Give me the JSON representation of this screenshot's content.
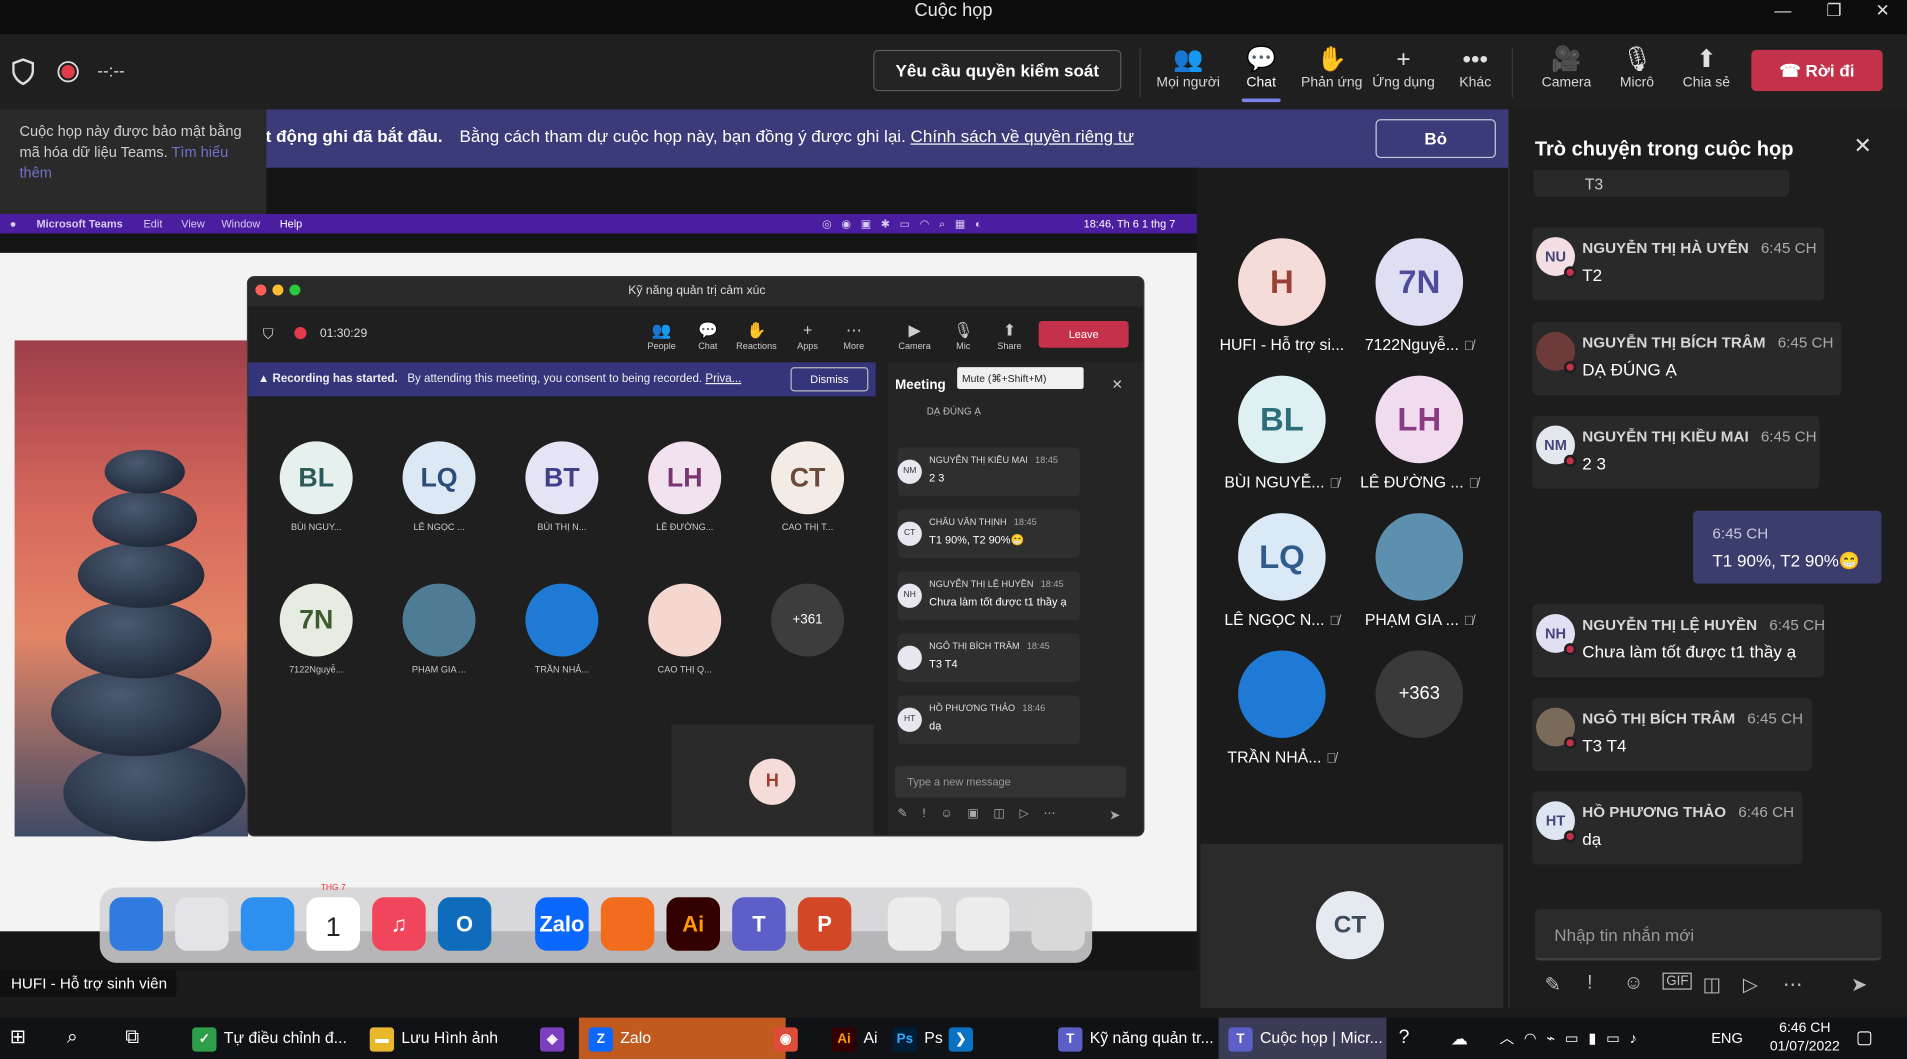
{
  "window": {
    "title": "Cuộc họp",
    "min": "—",
    "max": "❐",
    "close": "✕"
  },
  "meeting": {
    "timer": "--:--",
    "request_control": "Yêu cầu quyền kiểm soát",
    "toolbar": [
      {
        "label": "Mọi người",
        "icon": "people-icon",
        "glyph": "👥"
      },
      {
        "label": "Chat",
        "icon": "chat-icon",
        "glyph": "💬"
      },
      {
        "label": "Phản ứng",
        "icon": "reactions-icon",
        "glyph": "✋"
      },
      {
        "label": "Ứng dụng",
        "icon": "apps-icon",
        "glyph": "+"
      },
      {
        "label": "Khác",
        "icon": "more-icon",
        "glyph": "•••"
      }
    ],
    "av_controls": [
      {
        "label": "Camera",
        "icon": "camera-off-icon",
        "glyph": "🎥"
      },
      {
        "label": "Micrô",
        "icon": "mic-off-icon",
        "glyph": "🎙"
      },
      {
        "label": "Chia sẻ",
        "icon": "share-icon",
        "glyph": "⬆"
      }
    ],
    "leave": "Rời đi"
  },
  "encryption_popup": {
    "text": "Cuộc họp này được bảo mật bằng mã hóa dữ liệu Teams.",
    "link": "Tìm hiểu thêm"
  },
  "recording_banner": {
    "bold": "Hoạt động ghi đã bắt đầu.",
    "text": "Bằng cách tham dự cuộc họp này, bạn đồng ý được ghi lại.",
    "link": "Chính sách về quyền riêng tư",
    "dismiss": "Bỏ"
  },
  "shared_screen": {
    "menubar": {
      "app": "Microsoft Teams",
      "items": [
        "Edit",
        "View",
        "Window",
        "Help"
      ],
      "clock": "18:46, Th 6 1 thg 7"
    },
    "window_title": "Kỹ năng quản trị cảm xúc",
    "timer": "01:30:29",
    "toolbar": [
      "People",
      "Chat",
      "Reactions",
      "Apps",
      "More",
      "Camera",
      "Mic",
      "Share"
    ],
    "leave": "Leave",
    "tooltip": "Mute (⌘+Shift+M)",
    "banner_bold": "Recording has started.",
    "banner_text": "By attending this meeting, you consent to being recorded.",
    "banner_link": "Priva...",
    "dismiss": "Dismiss",
    "participants": [
      {
        "initials": "BL",
        "name": "BÙI NGUY..."
      },
      {
        "initials": "LQ",
        "name": "LÊ NGỌC ..."
      },
      {
        "initials": "BT",
        "name": "BÙI THỊ N..."
      },
      {
        "initials": "LH",
        "name": "LÊ ĐƯỜNG..."
      },
      {
        "initials": "CT",
        "name": "CAO THỊ T..."
      },
      {
        "initials": "7N",
        "name": "7122Nguyễ..."
      },
      {
        "initials": "",
        "name": "PHẠM GIA ..."
      },
      {
        "initials": "",
        "name": "TRẦN NHẢ..."
      },
      {
        "initials": "",
        "name": "CAO THỊ Q..."
      },
      {
        "initials": "+361",
        "name": ""
      }
    ],
    "self": "H",
    "chat_title": "Meeting",
    "chat_prev": "DẠ ĐÚNG Ạ",
    "messages": [
      {
        "initials": "NM",
        "name": "NGUYỄN THỊ KIỀU MAI",
        "time": "18:45",
        "text": "2 3"
      },
      {
        "initials": "CT",
        "name": "CHÂU VĂN THỊNH",
        "time": "18:45",
        "text": "T1 90%, T2 90%😁"
      },
      {
        "initials": "NH",
        "name": "NGUYỄN THỊ LỆ HUYỀN",
        "time": "18:45",
        "text": "Chưa làm tốt được t1 thầy ạ"
      },
      {
        "initials": "",
        "name": "NGÔ THỊ BÍCH TRÂM",
        "time": "18:45",
        "text": "T3 T4"
      },
      {
        "initials": "HT",
        "name": "HỒ PHƯƠNG THẢO",
        "time": "18:46",
        "text": "dạ"
      }
    ],
    "compose_placeholder": "Type a new message"
  },
  "dock": [
    {
      "label": "",
      "icon": "finder-icon",
      "color": "#2f7be0"
    },
    {
      "label": "",
      "icon": "launchpad-icon",
      "color": "#e4e4e8"
    },
    {
      "label": "",
      "icon": "safari-icon",
      "color": "#2d8ff0"
    },
    {
      "label": "1",
      "sub": "THG 7",
      "icon": "calendar-icon",
      "color": "#ffffff"
    },
    {
      "label": "♫",
      "icon": "music-icon",
      "color": "#f0455a"
    },
    {
      "label": "O",
      "icon": "outlook-icon",
      "color": "#0f6cbd"
    },
    {
      "label": "Zalo",
      "icon": "zalo-icon",
      "color": "#0a68ff"
    },
    {
      "label": "",
      "icon": "firefox-icon",
      "color": "#f26c1d"
    },
    {
      "label": "Ai",
      "icon": "illustrator-icon",
      "color": "#330000"
    },
    {
      "label": "T",
      "icon": "teams-icon",
      "color": "#5b5fc7"
    },
    {
      "label": "P",
      "icon": "powerpoint-icon",
      "color": "#d24726"
    },
    {
      "label": "",
      "icon": "window-thumb-icon",
      "color": "#ececec"
    },
    {
      "label": "",
      "icon": "window-thumb-icon",
      "color": "#ececec"
    },
    {
      "label": "",
      "icon": "trash-icon",
      "color": "#d9d9d9"
    }
  ],
  "presenter_tag": "HUFI - Hỗ trợ sinh viên",
  "participants": [
    {
      "initials": "H",
      "name": "HUFI - Hỗ trợ si...",
      "color": "#f6dcd8",
      "text": "#9a4235",
      "muted": false
    },
    {
      "initials": "7N",
      "name": "7122Nguyễ...",
      "color": "#dfdff3",
      "text": "#4c4c9a",
      "muted": true
    },
    {
      "initials": "BL",
      "name": "BÙI NGUYỄ...",
      "color": "#dff0f2",
      "text": "#2e6e78",
      "muted": true
    },
    {
      "initials": "LH",
      "name": "LÊ ĐƯỜNG ...",
      "color": "#f1dcef",
      "text": "#8a3b83",
      "muted": true
    },
    {
      "initials": "LQ",
      "name": "LÊ NGỌC N...",
      "color": "#dbe8f6",
      "text": "#2f5c8c",
      "muted": true
    },
    {
      "initials": "",
      "name": "PHẠM GIA ...",
      "color": "#5d8fae",
      "text": "#fff",
      "muted": true
    },
    {
      "initials": "",
      "name": "TRẦN NHẢ...",
      "color": "#1f7ad6",
      "text": "#fff",
      "muted": true
    },
    {
      "initials": "+363",
      "name": "",
      "color": "#3a3a3a",
      "text": "#fff",
      "muted": false
    }
  ],
  "self_view": {
    "initials": "CT"
  },
  "chat_panel": {
    "title": "Trò chuyện trong cuộc họp",
    "prev_tail": "T3",
    "messages": [
      {
        "initials": "NU",
        "name": "NGUYỄN THỊ HÀ UYÊN",
        "time": "6:45 CH",
        "text": "T2"
      },
      {
        "initials": "",
        "name": "NGUYỄN THỊ BÍCH TRÂM",
        "time": "6:45 CH",
        "text": "DẠ ĐÚNG Ạ"
      },
      {
        "initials": "NM",
        "name": "NGUYỄN THỊ KIỀU MAI",
        "time": "6:45 CH",
        "text": "2 3"
      },
      {
        "initials": "NH",
        "name": "NGUYỄN THỊ LỆ HUYỀN",
        "time": "6:45 CH",
        "text": "Chưa làm tốt được t1 thầy ạ"
      },
      {
        "initials": "",
        "name": "NGÔ THỊ BÍCH TRÂM",
        "time": "6:45 CH",
        "text": "T3 T4"
      },
      {
        "initials": "HT",
        "name": "HỒ PHƯƠNG THẢO",
        "time": "6:46 CH",
        "text": "dạ"
      }
    ],
    "my_message": {
      "time": "6:45 CH",
      "text": "T1 90%, T2 90%😁"
    },
    "compose_placeholder": "Nhập tin nhắn mới"
  },
  "taskbar": {
    "items": [
      {
        "label": "Tự điều chỉnh đ...",
        "icon": "green-app-icon"
      },
      {
        "label": "Lưu Hình ảnh",
        "icon": "folder-icon"
      },
      {
        "label": "",
        "icon": "visual-studio-icon"
      },
      {
        "label": "Zalo",
        "icon": "zalo-icon"
      },
      {
        "label": "",
        "icon": "chrome-icon"
      },
      {
        "label": "Ai",
        "icon": "illustrator-icon"
      },
      {
        "label": "Ps",
        "icon": "photoshop-icon"
      },
      {
        "label": "",
        "icon": "vscode-icon"
      },
      {
        "label": "Kỹ năng quản tr...",
        "icon": "teams-icon"
      },
      {
        "label": "Cuộc họp | Micr...",
        "icon": "teams-icon"
      }
    ],
    "lang": "ENG",
    "time": "6:46 CH",
    "date": "01/07/2022"
  }
}
